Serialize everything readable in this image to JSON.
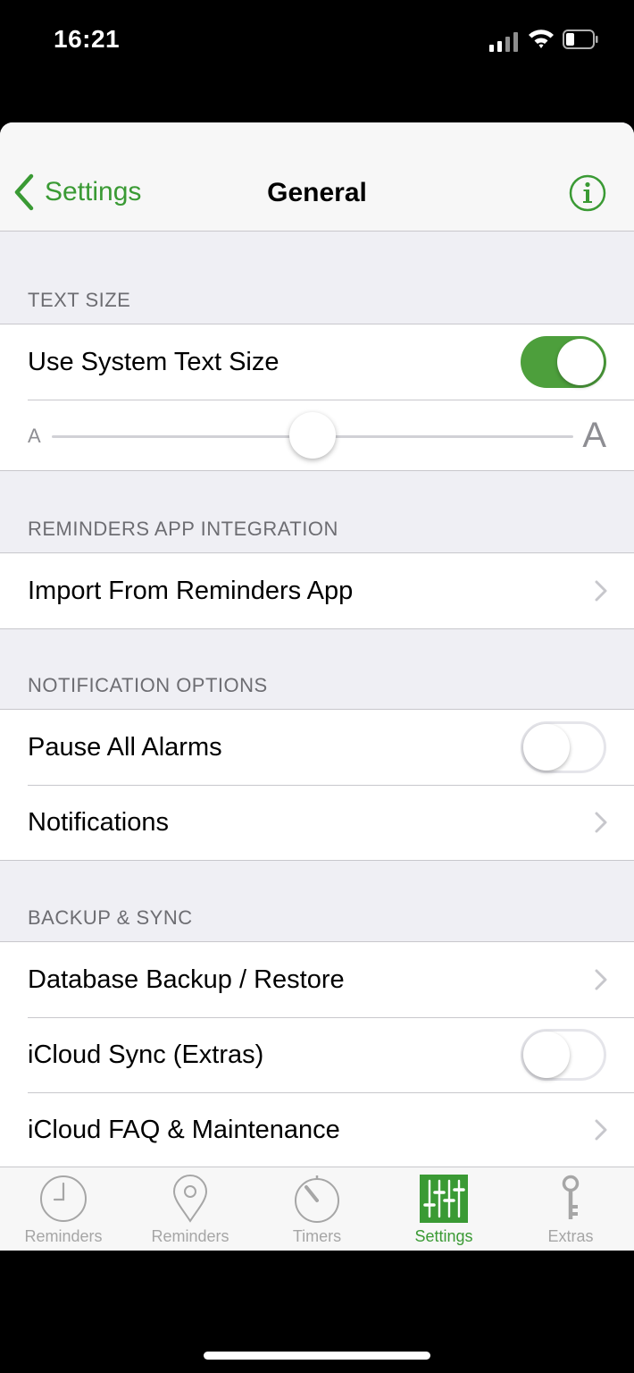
{
  "status": {
    "time": "16:21"
  },
  "nav": {
    "back_label": "Settings",
    "title": "General"
  },
  "sections": {
    "text_size": {
      "header": "TEXT SIZE",
      "system_text_label": "Use System Text Size",
      "system_text_on": true,
      "small_a": "A",
      "large_a": "A",
      "slider_value": 0.5
    },
    "reminders": {
      "header": "REMINDERS APP INTEGRATION",
      "import_label": "Import From Reminders App"
    },
    "notifications": {
      "header": "NOTIFICATION OPTIONS",
      "pause_label": "Pause All Alarms",
      "pause_on": false,
      "notifications_label": "Notifications"
    },
    "backup": {
      "header": "BACKUP & SYNC",
      "database_label": "Database Backup / Restore",
      "icloud_label": "iCloud Sync (Extras)",
      "icloud_on": false,
      "faq_label": "iCloud FAQ & Maintenance"
    }
  },
  "tabs": [
    {
      "label": "Reminders",
      "icon": "clock-icon"
    },
    {
      "label": "Reminders",
      "icon": "location-pin-icon"
    },
    {
      "label": "Timers",
      "icon": "stopwatch-icon"
    },
    {
      "label": "Settings",
      "icon": "sliders-icon",
      "active": true
    },
    {
      "label": "Extras",
      "icon": "key-icon"
    }
  ],
  "colors": {
    "accent": "#3a9a34",
    "toggle_on": "#4d9f3c",
    "background": "#efeff4",
    "inactive_tab": "#a6a6a6"
  }
}
